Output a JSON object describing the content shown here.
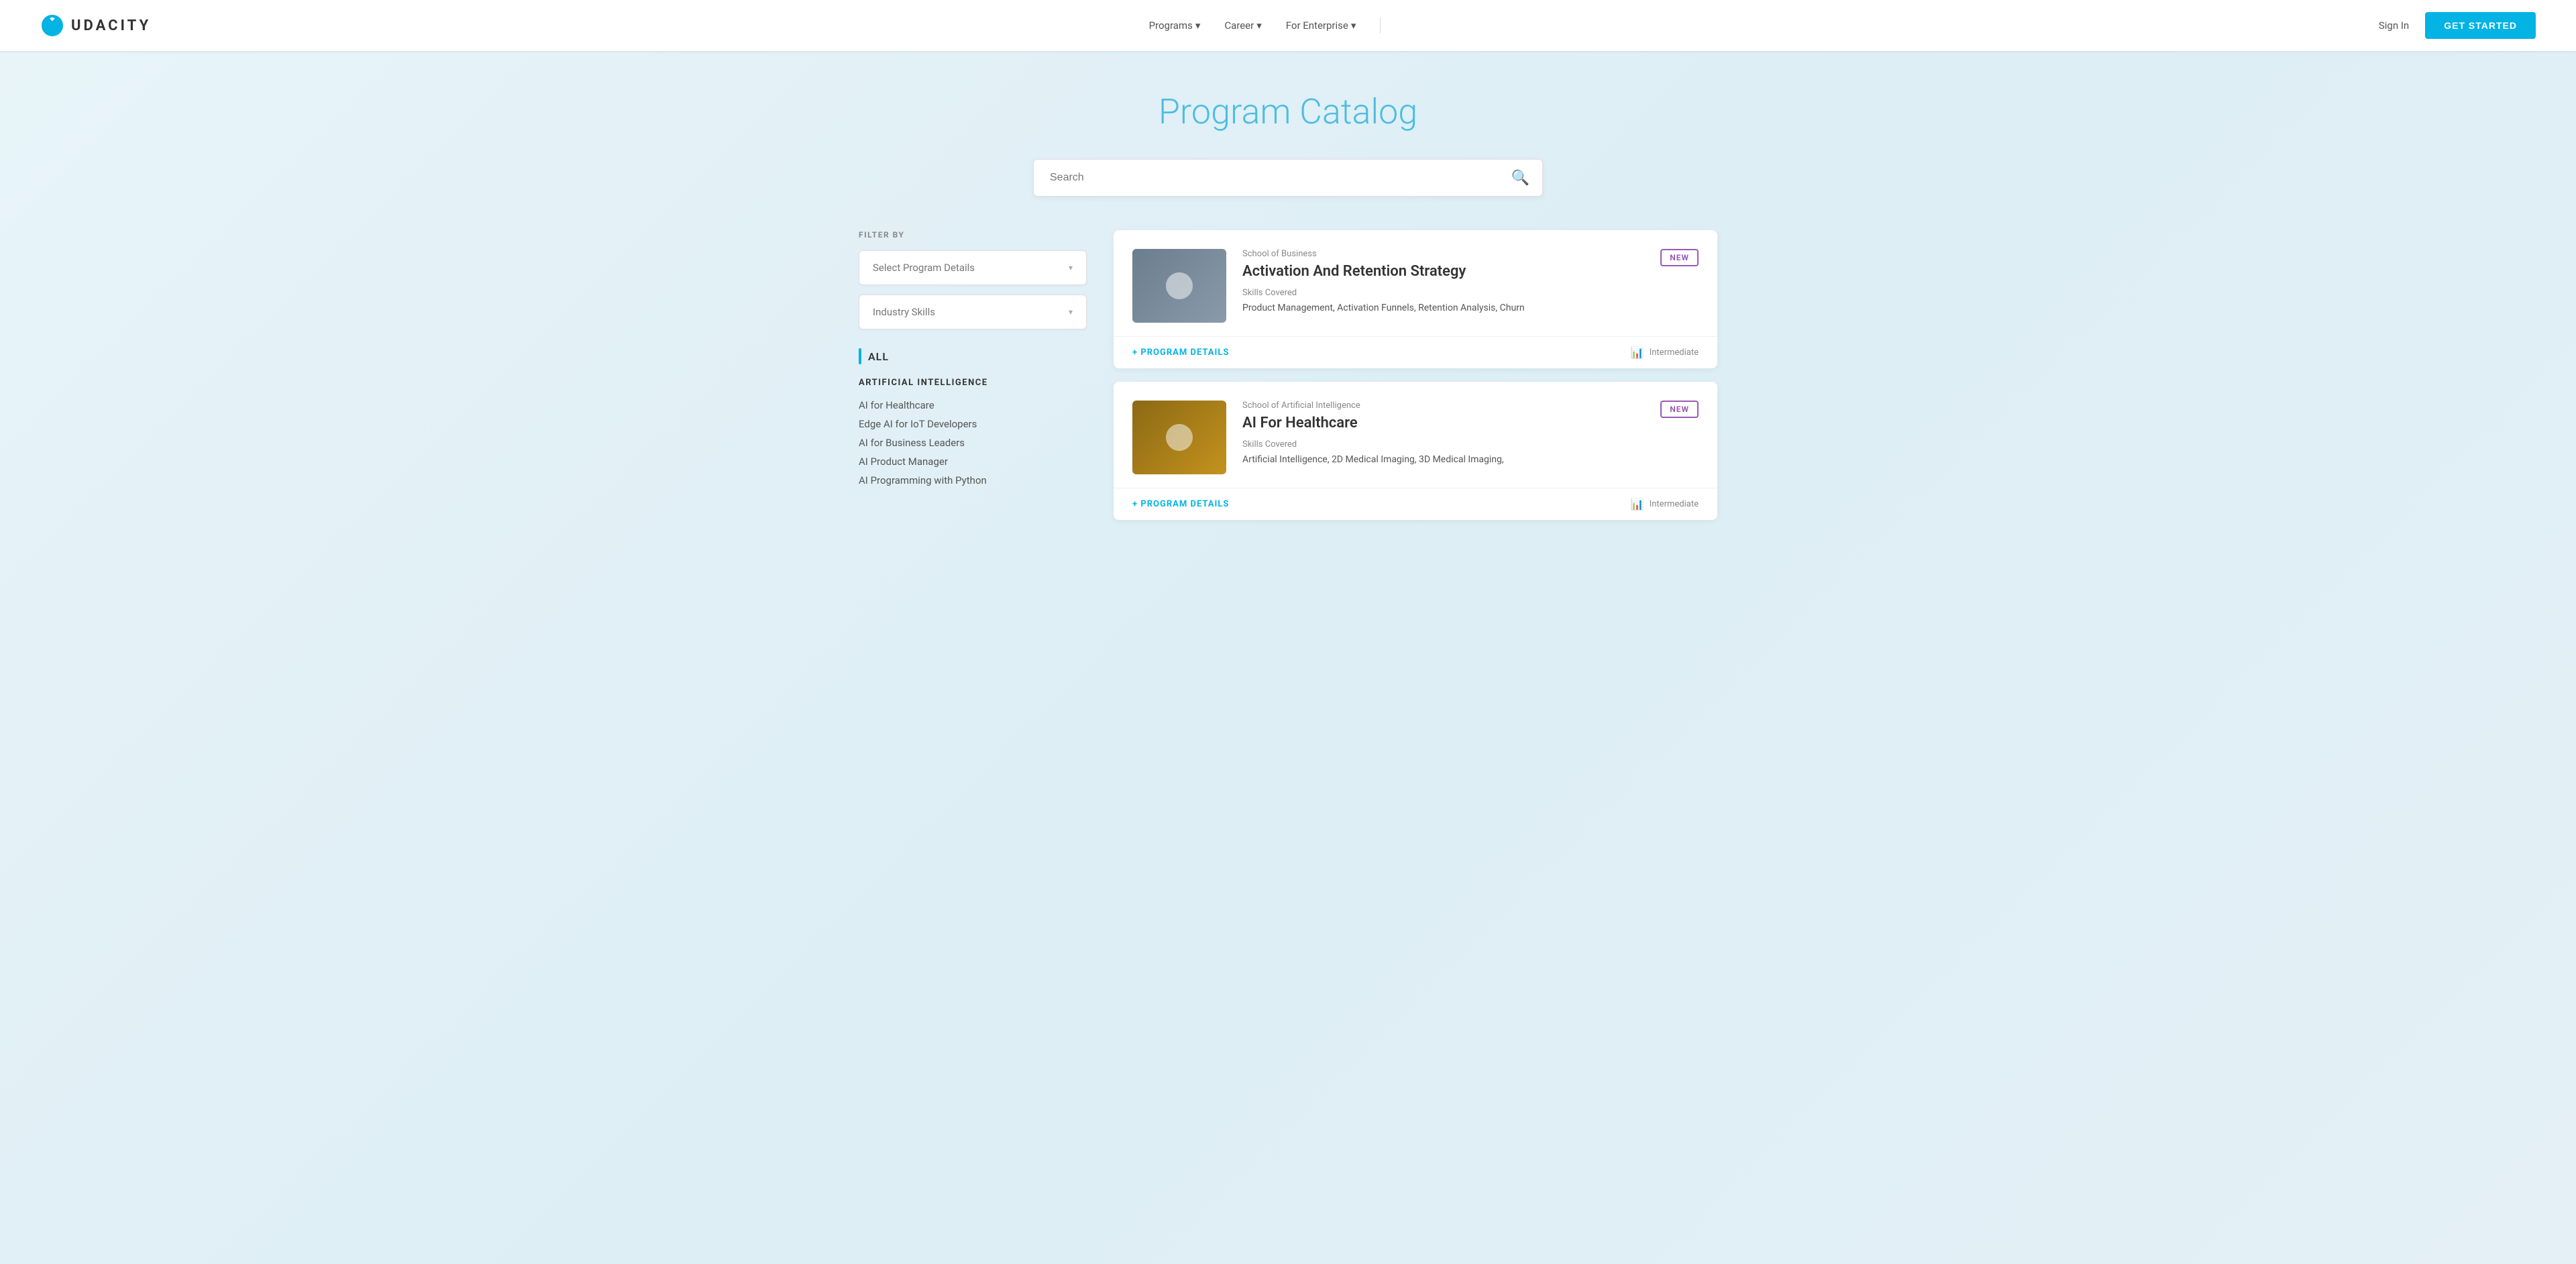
{
  "navbar": {
    "logo_text": "UDACITY",
    "nav_links": [
      {
        "label": "Programs",
        "has_dropdown": true
      },
      {
        "label": "Career",
        "has_dropdown": true
      },
      {
        "label": "For Enterprise",
        "has_dropdown": true
      }
    ],
    "sign_in_label": "Sign In",
    "get_started_label": "GET STARTED"
  },
  "page": {
    "title": "Program Catalog"
  },
  "search": {
    "placeholder": "Search"
  },
  "sidebar": {
    "filter_by_label": "FILTER BY",
    "dropdown_1_placeholder": "Select Program Details",
    "dropdown_2_placeholder": "Industry Skills",
    "all_label": "ALL",
    "categories": [
      {
        "title": "ARTIFICIAL INTELLIGENCE",
        "items": [
          "AI for Healthcare",
          "Edge AI for IoT Developers",
          "AI for Business Leaders",
          "AI Product Manager",
          "AI Programming with Python"
        ]
      }
    ]
  },
  "cards": [
    {
      "school": "School of Business",
      "title": "Activation And Retention Strategy",
      "skills_label": "Skills Covered",
      "skills": "Product Management, Activation Funnels, Retention Analysis, Churn",
      "badge": "NEW",
      "program_details_label": "+ PROGRAM DETAILS",
      "level": "Intermediate",
      "thumbnail_type": "business"
    },
    {
      "school": "School of Artificial Intelligence",
      "title": "AI For Healthcare",
      "skills_label": "Skills Covered",
      "skills": "Artificial Intelligence, 2D Medical Imaging, 3D Medical Imaging,",
      "badge": "NEW",
      "program_details_label": "+ PROGRAM DETAILS",
      "level": "Intermediate",
      "thumbnail_type": "ai"
    }
  ]
}
